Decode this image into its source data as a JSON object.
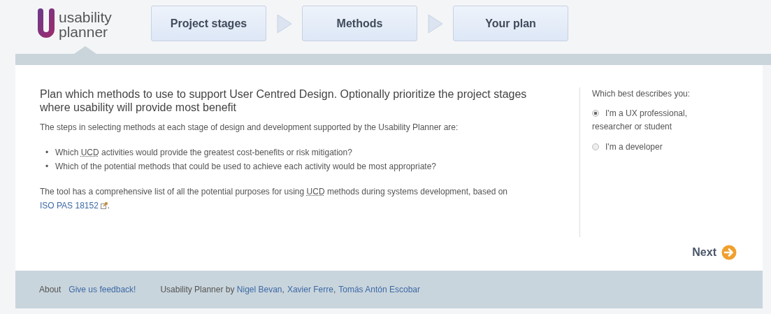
{
  "logo": {
    "line1": "usability",
    "line2": "planner"
  },
  "stages": [
    {
      "label": "Project stages",
      "selected": false
    },
    {
      "label": "Methods",
      "selected": false
    },
    {
      "label": "Your plan",
      "selected": false
    }
  ],
  "intro": {
    "heading": "Plan which methods to use to support User Centred Design. Optionally prioritize the project stages where usability will provide most benefit",
    "lead": "The steps in selecting methods at each stage of design and development supported by the Usability Planner are:",
    "marker": "•",
    "bullets": [
      [
        {
          "text": "Which "
        },
        {
          "text": "UCD",
          "kind": "abbr"
        },
        {
          "text": " activities would provide the greatest cost-benefits or risk mitigation?"
        }
      ],
      [
        {
          "text": "Which of the potential methods that could be used to achieve each activity would be most appropriate?"
        }
      ]
    ],
    "closing": [
      {
        "text": "The tool has a comprehensive list of all the potential purposes for using "
      },
      {
        "text": "UCD",
        "kind": "abbr"
      },
      {
        "text": " methods during systems development, based on "
      },
      {
        "text": "ISO PAS 18152",
        "kind": "link"
      },
      {
        "kind": "external"
      },
      {
        "text": "."
      }
    ]
  },
  "side": {
    "question": "Which best describes you:",
    "options": [
      {
        "label": "I'm a UX professional, researcher or student",
        "selected": true
      },
      {
        "label": "I'm a developer",
        "selected": false
      }
    ]
  },
  "next": "Next",
  "footer": {
    "about": "About",
    "feedback": "Give us feedback!",
    "credit_prefix": "Usability Planner by",
    "separator": ",",
    "authors": [
      "Nigel Bevan",
      "Xavier Ferre",
      "Tomás Antón Escobar"
    ]
  }
}
